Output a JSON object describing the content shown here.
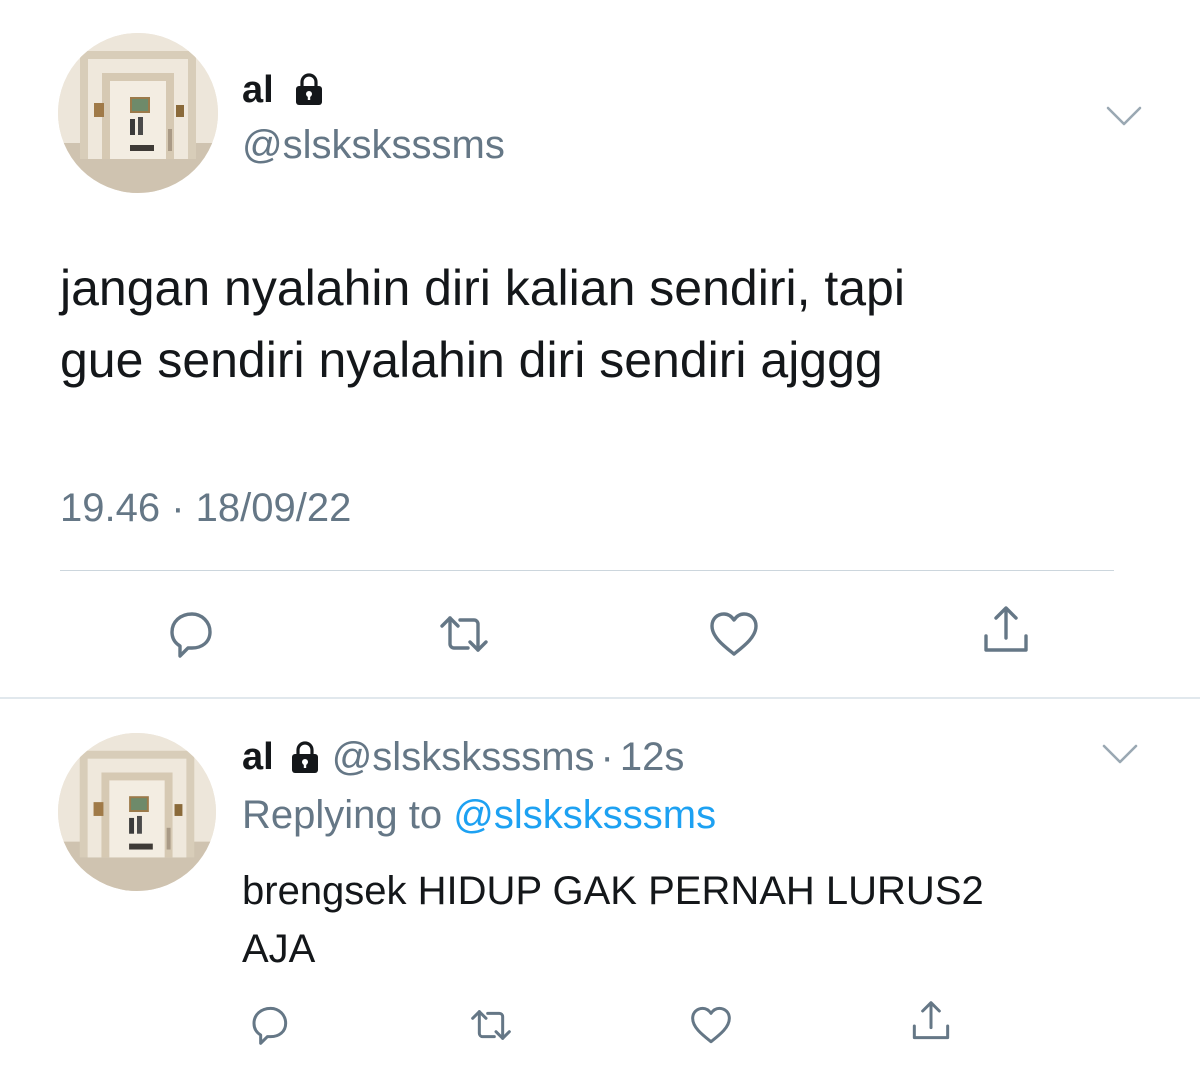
{
  "main_tweet": {
    "display_name": "al",
    "lock_icon": "lock-icon",
    "handle": "@slsksksssms",
    "text": "jangan nyalahin diri kalian sendiri, tapi\ngue sendiri nyalahin diri sendiri ajggg",
    "timestamp": "19.46 · 18/09/22",
    "menu_icon": "chevron-down-icon",
    "actions": [
      "reply-icon",
      "retweet-icon",
      "like-icon",
      "share-icon"
    ]
  },
  "reply_tweet": {
    "display_name": "al",
    "handle": "@slsksksssms",
    "separator": "·",
    "time_ago": "12s",
    "replying_prefix": "Replying to",
    "replying_handle": "@slsksksssms",
    "text": "brengsek HIDUP GAK PERNAH LURUS2\nAJA",
    "menu_icon": "chevron-down-icon",
    "actions": [
      "reply-icon",
      "retweet-icon",
      "like-icon",
      "share-icon"
    ]
  },
  "colors": {
    "primary_text": "#14171a",
    "secondary_text": "#657786",
    "link": "#1da1f2",
    "divider": "#ccd6dd"
  }
}
